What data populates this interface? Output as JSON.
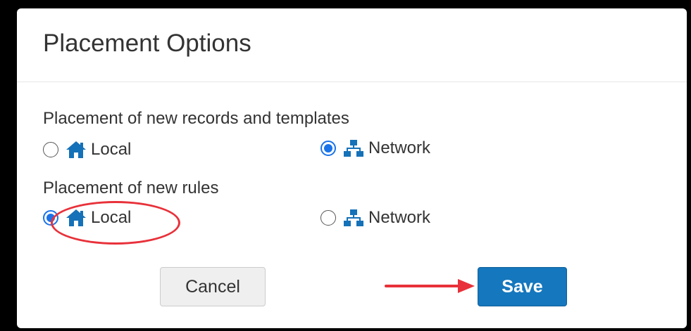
{
  "dialog": {
    "title": "Placement Options"
  },
  "sections": {
    "records": {
      "label": "Placement of new records and templates",
      "options": [
        {
          "label": "Local",
          "icon": "home-icon",
          "checked": false
        },
        {
          "label": "Network",
          "icon": "sitemap-icon",
          "checked": true
        }
      ]
    },
    "rules": {
      "label": "Placement of new rules",
      "options": [
        {
          "label": "Local",
          "icon": "home-icon",
          "checked": true
        },
        {
          "label": "Network",
          "icon": "sitemap-icon",
          "checked": false
        }
      ]
    }
  },
  "buttons": {
    "cancel_label": "Cancel",
    "save_label": "Save"
  },
  "colors": {
    "icon": "#1571b8",
    "radio_checked": "#1a73e8",
    "save_button": "#1577bd",
    "annotation": "#e8313a"
  }
}
